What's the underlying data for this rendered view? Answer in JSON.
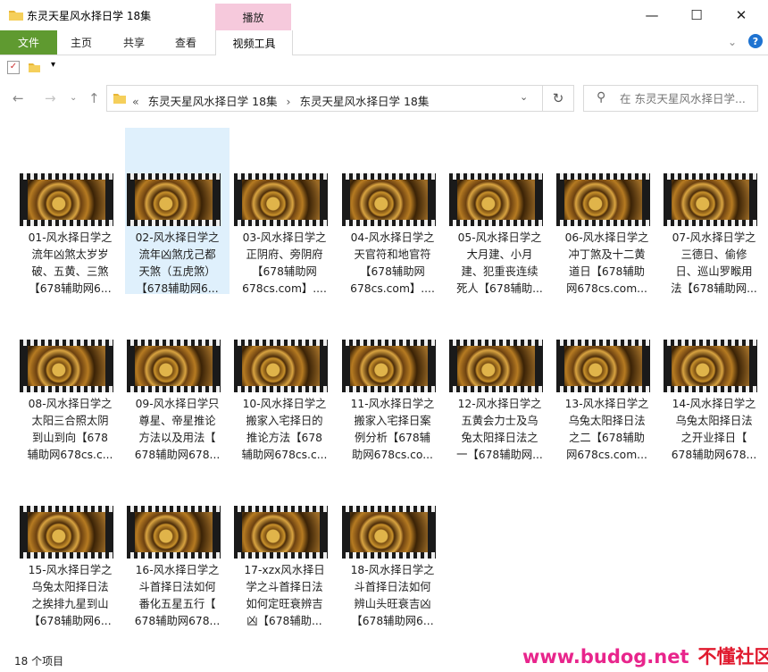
{
  "window": {
    "title": "东灵天星风水择日学 18集",
    "min_icon": "—",
    "max_icon": "☐",
    "close_icon": "✕"
  },
  "ribbon": {
    "file_tab": "文件",
    "tabs": [
      "主页",
      "共享",
      "查看"
    ],
    "context_group": "播放",
    "context_tab": "视频工具",
    "help_label": "?"
  },
  "address": {
    "prefix": "«",
    "crumbs": [
      "东灵天星风水择日学 18集",
      "东灵天星风水择日学 18集"
    ],
    "separator": "›"
  },
  "search": {
    "placeholder": "在 东灵天星风水择日学..."
  },
  "items": [
    {
      "label": "01-风水择日学之\n流年凶煞太岁岁\n破、五黄、三煞\n【678辅助网6..."
    },
    {
      "label": "02-风水择日学之\n流年凶煞戊己都\n天煞（五虎煞）\n【678辅助网6..."
    },
    {
      "label": "03-风水择日学之\n正阴府、旁阴府\n【678辅助网\n678cs.com】...."
    },
    {
      "label": "04-风水择日学之\n天官符和地官符\n【678辅助网\n678cs.com】...."
    },
    {
      "label": "05-风水择日学之\n大月建、小月\n建、犯重丧连续\n死人【678辅助..."
    },
    {
      "label": "06-风水择日学之\n冲丁煞及十二黄\n道日【678辅助\n网678cs.com..."
    },
    {
      "label": "07-风水择日学之\n三德日、偷修\n日、巡山罗睺用\n法【678辅助网..."
    },
    {
      "label": "08-风水择日学之\n太阳三合照太阴\n到山到向【678\n辅助网678cs.c..."
    },
    {
      "label": "09-风水择日学只\n尊星、帝星推论\n方法以及用法【\n678辅助网678..."
    },
    {
      "label": "10-风水择日学之\n搬家入宅择日的\n推论方法【678\n辅助网678cs.c..."
    },
    {
      "label": "11-风水择日学之\n搬家入宅择日案\n例分析【678辅\n助网678cs.co..."
    },
    {
      "label": "12-风水择日学之\n五黄会力士及乌\n兔太阳择日法之\n一【678辅助网..."
    },
    {
      "label": "13-风水择日学之\n乌兔太阳择日法\n之二【678辅助\n网678cs.com..."
    },
    {
      "label": "14-风水择日学之\n乌兔太阳择日法\n之开业择日【\n678辅助网678..."
    },
    {
      "label": "15-风水择日学之\n乌兔太阳择日法\n之挨排九星到山\n【678辅助网6..."
    },
    {
      "label": "16-风水择日学之\n斗首择日法如何\n番化五星五行【\n678辅助网678..."
    },
    {
      "label": "17-xzx风水择日\n学之斗首择日法\n如何定旺衰辨吉\n凶【678辅助..."
    },
    {
      "label": "18-风水择日学之\n斗首择日法如何\n辨山头旺衰吉凶\n【678辅助网6..."
    }
  ],
  "status": {
    "count": "18 个项目"
  },
  "watermark": {
    "site": "www.budog.net",
    "name": "不懂社区"
  }
}
